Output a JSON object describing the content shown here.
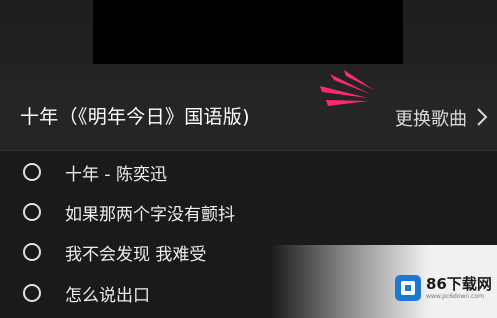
{
  "header": {
    "song_title": "十年（《明年今日》国语版)",
    "change_song_label": "更换歌曲"
  },
  "songs": [
    {
      "label": "十年 - 陈奕迅"
    },
    {
      "label": "如果那两个字没有颤抖"
    },
    {
      "label": "我不会发现 我难受"
    },
    {
      "label": "怎么说出口"
    }
  ],
  "watermark": {
    "name": "86下载网",
    "url": "www.pc6down.com"
  },
  "colors": {
    "background": "#161616",
    "pointer_arrow": "#ff2a6d",
    "watermark_blue": "#1d78d2"
  },
  "icons": {
    "chevron": "chevron-right-icon",
    "radio": "radio-unselected-icon",
    "pointer": "red-pointer-arrow-icon"
  }
}
